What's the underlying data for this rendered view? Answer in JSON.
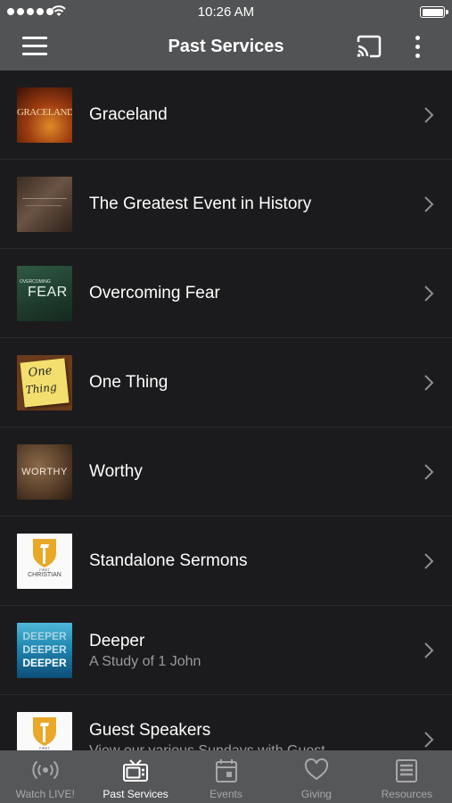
{
  "status_bar": {
    "time": "10:26 AM"
  },
  "nav": {
    "title": "Past Services"
  },
  "series": [
    {
      "title": "Graceland",
      "thumb_text": "GRACELAND"
    },
    {
      "title": "The Greatest Event in History"
    },
    {
      "title": "Overcoming Fear",
      "thumb_text_small": "OVERCOMING",
      "thumb_text": "FEAR"
    },
    {
      "title": "One Thing",
      "thumb_text_1": "One",
      "thumb_text_2": "Thing"
    },
    {
      "title": "Worthy",
      "thumb_text": "WORTHY"
    },
    {
      "title": "Standalone Sermons",
      "thumb_text": "CHRISTIAN",
      "thumb_text_small": "FIRST"
    },
    {
      "title": "Deeper",
      "subtitle": "A Study of 1 John",
      "thumb_text": "DEEPER"
    },
    {
      "title": "Guest Speakers",
      "subtitle": "View our various Sundays with Guest",
      "thumb_text_small": "FIRST"
    }
  ],
  "tabs": [
    {
      "label": "Watch LIVE!",
      "icon": "broadcast-icon"
    },
    {
      "label": "Past Services",
      "icon": "tv-icon",
      "active": true
    },
    {
      "label": "Events",
      "icon": "calendar-icon"
    },
    {
      "label": "Giving",
      "icon": "heart-icon"
    },
    {
      "label": "Resources",
      "icon": "document-icon"
    }
  ]
}
